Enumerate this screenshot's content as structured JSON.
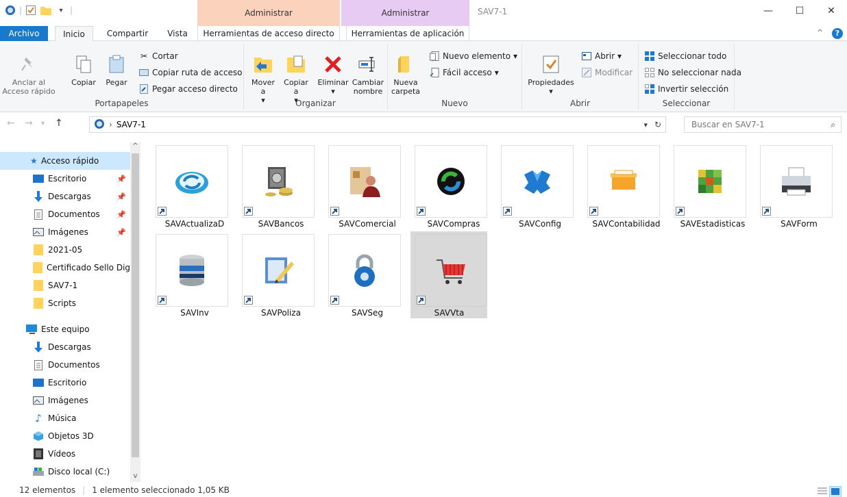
{
  "titlebar": {
    "title": "SAV7-1",
    "context_tab_1": "Administrar",
    "context_tab_2": "Administrar",
    "minimize": "—",
    "maximize": "☐",
    "close": "✕"
  },
  "tabs": {
    "file": "Archivo",
    "home": "Inicio",
    "share": "Compartir",
    "view": "Vista",
    "shortcut_tools": "Herramientas de acceso directo",
    "app_tools": "Herramientas de aplicación"
  },
  "ribbon": {
    "clipboard": {
      "label": "Portapapeles",
      "pin": "Anclar al Acceso rápido",
      "copy": "Copiar",
      "paste": "Pegar",
      "cut": "Cortar",
      "copy_path": "Copiar ruta de acceso",
      "paste_shortcut": "Pegar acceso directo"
    },
    "organize": {
      "label": "Organizar",
      "move": "Mover a",
      "copy": "Copiar a",
      "delete": "Eliminar",
      "rename": "Cambiar nombre"
    },
    "new": {
      "label": "Nuevo",
      "new_folder": "Nueva carpeta",
      "new_item": "Nuevo elemento",
      "easy_access": "Fácil acceso"
    },
    "open": {
      "label": "Abrir",
      "properties": "Propiedades",
      "open": "Abrir",
      "edit": "Modificar"
    },
    "select": {
      "label": "Seleccionar",
      "select_all": "Seleccionar todo",
      "select_none": "No seleccionar nada",
      "invert": "Invertir selección"
    }
  },
  "address": {
    "path": "SAV7-1",
    "search_placeholder": "Buscar en SAV7-1"
  },
  "nav": {
    "quick_access": "Acceso rápido",
    "items": [
      "Escritorio",
      "Descargas",
      "Documentos",
      "Imágenes",
      "2021-05",
      "Certificado Sello Digital",
      "SAV7-1",
      "Scripts"
    ],
    "this_pc": "Este equipo",
    "pc_items": [
      "Descargas",
      "Documentos",
      "Escritorio",
      "Imágenes",
      "Música",
      "Objetos 3D",
      "Vídeos",
      "Disco local (C:)"
    ]
  },
  "files": [
    {
      "name": "SAVActualizaD",
      "icon": "refresh-disc-icon"
    },
    {
      "name": "SAVBancos",
      "icon": "safe-coins-icon"
    },
    {
      "name": "SAVComercial",
      "icon": "contact-folder-icon"
    },
    {
      "name": "SAVCompras",
      "icon": "sync-arrows-icon"
    },
    {
      "name": "SAVConfig",
      "icon": "config-puzzle-icon"
    },
    {
      "name": "SAVContabilidad",
      "icon": "file-box-icon"
    },
    {
      "name": "SAVEstadisticas",
      "icon": "cube-icon"
    },
    {
      "name": "SAVForm",
      "icon": "printer-icon"
    },
    {
      "name": "SAVInv",
      "icon": "database-icon"
    },
    {
      "name": "SAVPoliza",
      "icon": "edit-document-icon"
    },
    {
      "name": "SAVSeg",
      "icon": "padlock-icon"
    },
    {
      "name": "SAVVta",
      "icon": "shopping-cart-icon",
      "selected": true
    }
  ],
  "status": {
    "count": "12 elementos",
    "selection": "1 elemento seleccionado 1,05 KB"
  },
  "colors": {
    "accent": "#1979ca",
    "selection": "#cce8ff",
    "ctx1": "#fbd3bd",
    "ctx2": "#e7cbf2"
  }
}
